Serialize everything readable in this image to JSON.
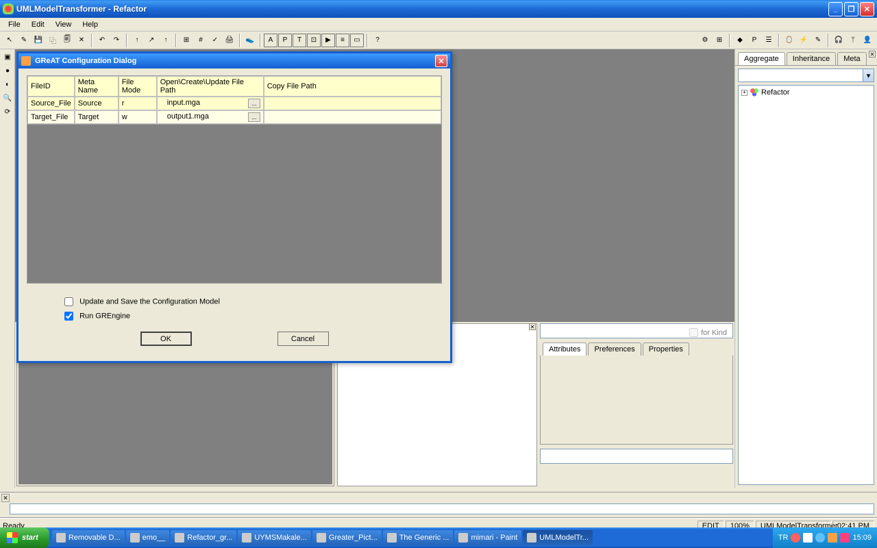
{
  "window": {
    "title": "UMLModelTransformer - Refactor",
    "min": "_",
    "max": "❐",
    "close": "✕"
  },
  "menubar": [
    "File",
    "Edit",
    "View",
    "Help"
  ],
  "toolbar_left_glyphs": [
    "↖",
    "✎",
    "💾",
    "⿻",
    "🗐",
    "✕",
    "|",
    "↶",
    "↷",
    "|",
    "↑",
    "↗",
    "↑",
    "|",
    "⊞",
    "#",
    "✓",
    "🖨",
    "|",
    "👟",
    "|"
  ],
  "toolbar_boxed": [
    "A",
    "P",
    "T",
    "⊡",
    "▶",
    "≡",
    "▭"
  ],
  "toolbar_help": "?",
  "toolbar_right_glyphs": [
    "⚙",
    "⊞",
    "|",
    "◆",
    "P",
    "☰",
    "|",
    "🪞",
    "⚡",
    "✎",
    "|",
    "🎧",
    "ᛘ",
    "👤"
  ],
  "left_tools": [
    "▣",
    "●",
    "◐",
    "🔍",
    "⟳"
  ],
  "right_panel": {
    "tabs": [
      "Aggregate",
      "Inheritance",
      "Meta"
    ],
    "tree_root": "Refactor",
    "expand": "+"
  },
  "dialog": {
    "title": "GReAT Configuration Dialog",
    "close": "✕",
    "columns": [
      "FileID",
      "Meta Name",
      "File Mode",
      "Open\\Create\\Update File Path",
      "Copy File Path"
    ],
    "rows": [
      {
        "fileid": "Source_File",
        "meta": "Source",
        "mode": "r",
        "path": "input.mga",
        "copy": ""
      },
      {
        "fileid": "Target_File",
        "meta": "Target",
        "mode": "w",
        "path": "output1.mga",
        "copy": ""
      }
    ],
    "browse": "...",
    "check_update": "Update and Save the Configuration Model",
    "check_update_val": false,
    "check_run": "Run GREngine",
    "check_run_val": true,
    "ok": "OK",
    "cancel": "Cancel"
  },
  "br_panel": {
    "forkind": "for Kind",
    "tabs": [
      "Attributes",
      "Preferences",
      "Properties"
    ]
  },
  "statusbar": {
    "ready": "Ready",
    "edit": "EDIT",
    "zoom": "100%",
    "model": "UMLModelTransformer",
    "time": "02:41 PM"
  },
  "taskbar": {
    "start": "start",
    "items": [
      "Removable D...",
      "emo__",
      "Refactor_gr...",
      "UYMSMakale...",
      "Greater_Pict...",
      "The Generic ...",
      "mimari - Paint",
      "UMLModelTr..."
    ],
    "lang": "TR",
    "clock": "15:09"
  }
}
